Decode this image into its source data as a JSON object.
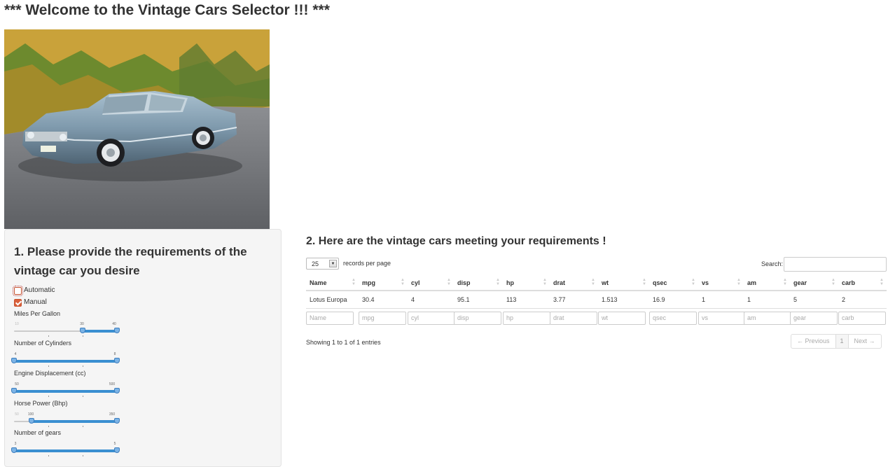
{
  "page_title": "*** Welcome to the Vintage Cars Selector !!! ***",
  "photo": {
    "plate_text": "BFR 613"
  },
  "sidebar": {
    "heading": "1. Please provide the requirements of the vintage car you desire",
    "checkboxes": [
      {
        "label": "Automatic",
        "checked": false
      },
      {
        "label": "Manual",
        "checked": true
      }
    ],
    "sliders": [
      {
        "label": "Miles Per Gallon",
        "min_label": "10",
        "low_label": "30",
        "max_label": "40",
        "min": 10,
        "max": 40,
        "low": 30,
        "high": 40
      },
      {
        "label": "Number of Cylinders",
        "min_label": "4",
        "max_label": "8",
        "min": 4,
        "max": 8,
        "low": 4,
        "high": 8
      },
      {
        "label": "Engine Displacement (cc)",
        "min_label": "50",
        "max_label": "500",
        "min": 50,
        "max": 500,
        "low": 50,
        "high": 500
      },
      {
        "label": "Horse Power (Bhp)",
        "min_label": "50",
        "low_label": "100",
        "max_label": "350",
        "min": 50,
        "max": 350,
        "low": 100,
        "high": 350
      },
      {
        "label": "Number of gears",
        "min_label": "3",
        "max_label": "5",
        "min": 3,
        "max": 5,
        "low": 3,
        "high": 5
      }
    ]
  },
  "main": {
    "heading": "2. Here are the vintage cars meeting your requirements !",
    "length_value": "25",
    "length_text": "records per page",
    "search_label": "Search:",
    "columns": [
      "Name",
      "mpg",
      "cyl",
      "disp",
      "hp",
      "drat",
      "wt",
      "qsec",
      "vs",
      "am",
      "gear",
      "carb"
    ],
    "rows": [
      [
        "Lotus Europa",
        "30.4",
        "4",
        "95.1",
        "113",
        "3.77",
        "1.513",
        "16.9",
        "1",
        "1",
        "5",
        "2"
      ]
    ],
    "filter_placeholders": [
      "Name",
      "mpg",
      "cyl",
      "disp",
      "hp",
      "drat",
      "wt",
      "qsec",
      "vs",
      "am",
      "gear",
      "carb"
    ],
    "info": "Showing 1 to 1 of 1 entries",
    "pager": {
      "previous": "← Previous",
      "current": "1",
      "next": "Next →"
    }
  }
}
